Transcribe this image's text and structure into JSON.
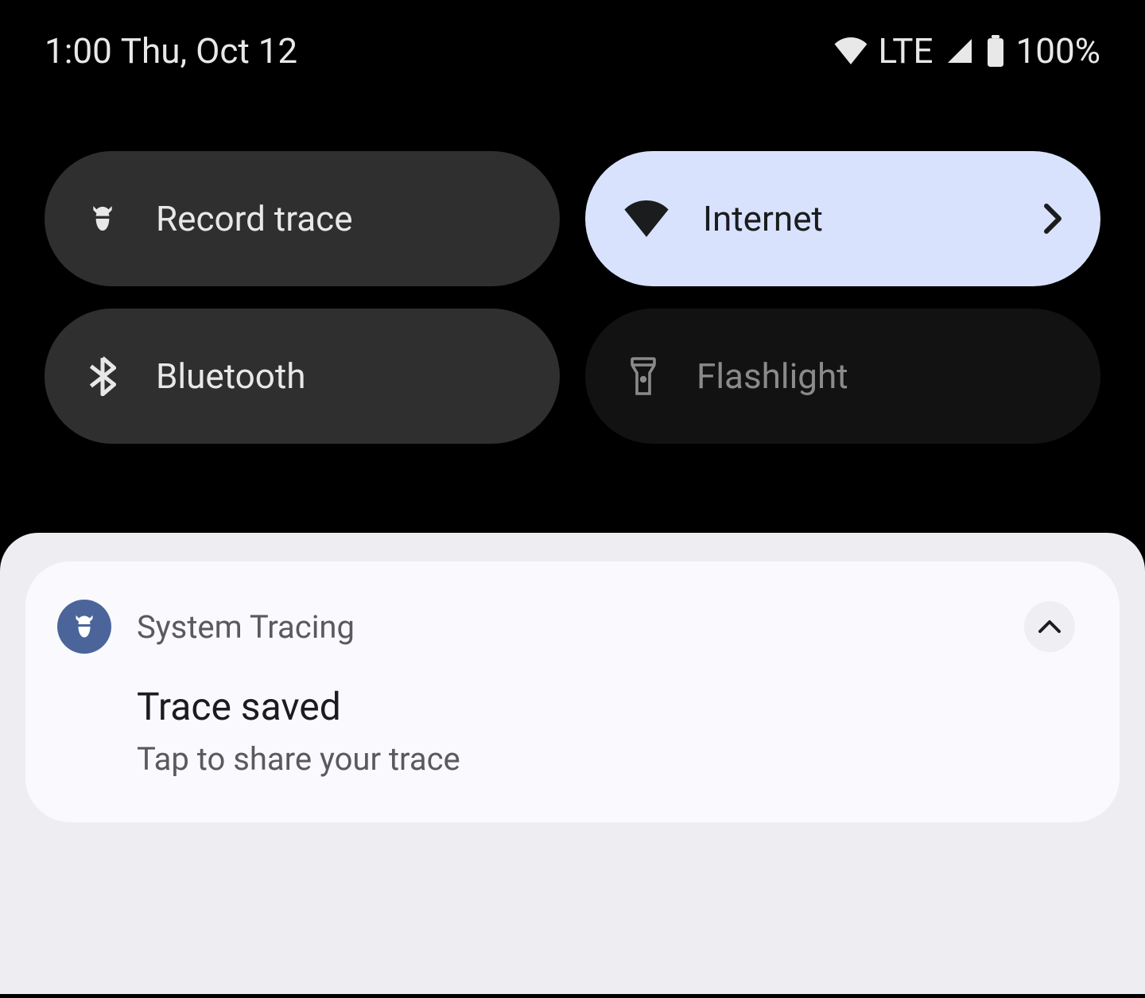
{
  "status": {
    "time": "1:00",
    "date": "Thu, Oct 12",
    "network": "LTE",
    "battery": "100%"
  },
  "tiles": [
    {
      "label": "Record trace"
    },
    {
      "label": "Internet"
    },
    {
      "label": "Bluetooth"
    },
    {
      "label": "Flashlight"
    }
  ],
  "notification": {
    "app_name": "System Tracing",
    "title": "Trace saved",
    "text": "Tap to share your trace"
  }
}
